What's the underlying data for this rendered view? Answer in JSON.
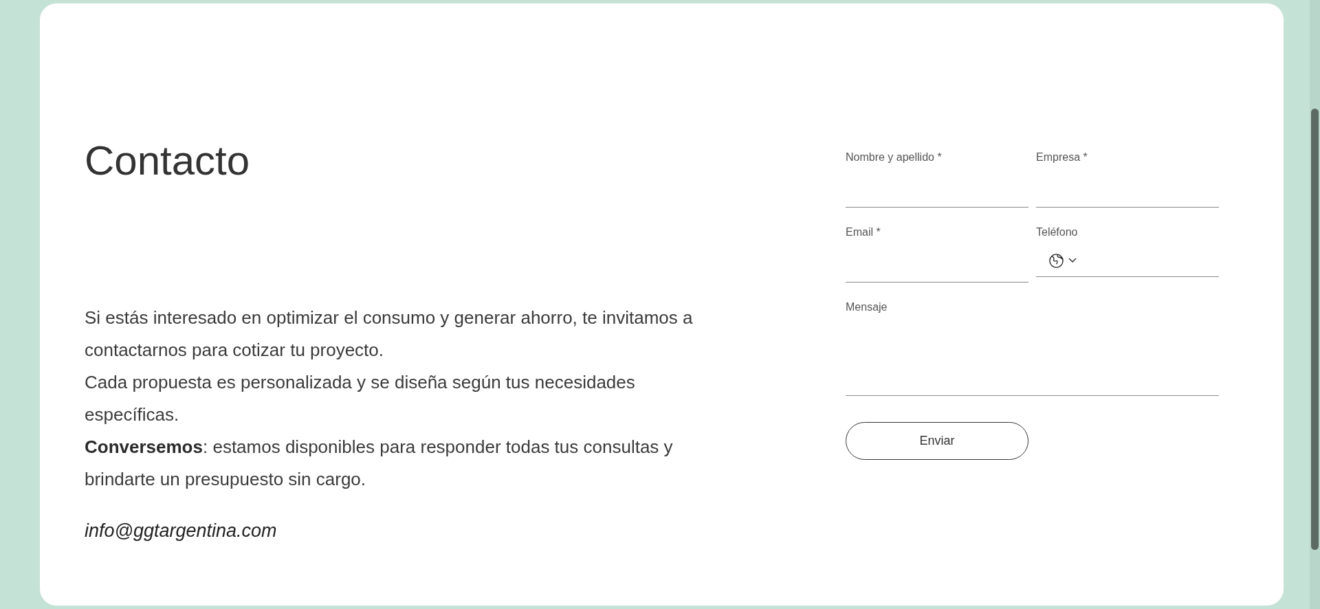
{
  "title": "Contacto",
  "paragraphs": [
    "Si estás interesado en optimizar el consumo y generar ahorro, te invitamos a contactarnos para cotizar tu proyecto.",
    "Cada propuesta es personalizada y se diseña según tus necesidades específicas.",
    "**Conversemos**: estamos disponibles para responder todas tus consultas y brindarte un presupuesto sin cargo."
  ],
  "email_link": "info@ggtargentina.com",
  "form": {
    "fields": [
      {
        "label": "Nombre y apellido *",
        "kind": "text"
      },
      {
        "label": "Empresa *",
        "kind": "text"
      },
      {
        "label": "Email *",
        "kind": "text"
      },
      {
        "label": "Teléfono",
        "kind": "phone"
      },
      {
        "label": "Mensaje",
        "kind": "textarea"
      }
    ],
    "submit": "Enviar"
  }
}
